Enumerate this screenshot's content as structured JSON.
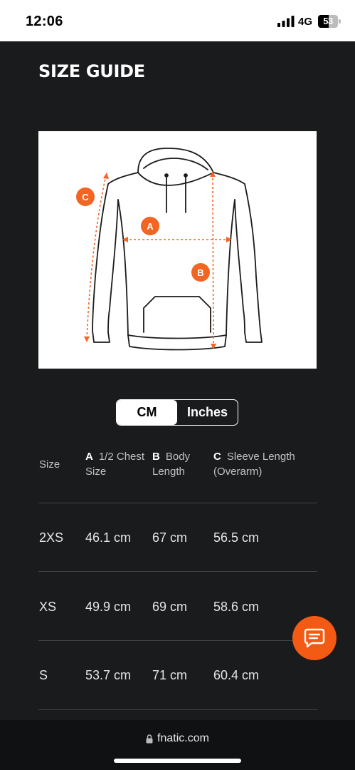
{
  "status_bar": {
    "time": "12:06",
    "network": "4G",
    "battery_percent": "53",
    "battery_level": 0.53,
    "icons": [
      "signal-icon",
      "battery-icon"
    ]
  },
  "page": {
    "title": "SIZE GUIDE"
  },
  "size_diagram": {
    "markers": {
      "a": "A",
      "b": "B",
      "c": "C"
    },
    "accent_color": "#f26522"
  },
  "unit_toggle": {
    "options": [
      "CM",
      "Inches"
    ],
    "selected": "CM"
  },
  "table": {
    "headers": {
      "size": "Size",
      "a_letter": "A",
      "a_label": "1/2 Chest Size",
      "b_letter": "B",
      "b_label": "Body Length",
      "c_letter": "C",
      "c_label": "Sleeve Length (Overarm)"
    },
    "rows": [
      {
        "size": "2XS",
        "a": "46.1 cm",
        "b": "67 cm",
        "c": "56.5 cm"
      },
      {
        "size": "XS",
        "a": "49.9 cm",
        "b": "69 cm",
        "c": "58.6 cm"
      },
      {
        "size": "S",
        "a": "53.7 cm",
        "b": "71 cm",
        "c": "60.4 cm"
      }
    ]
  },
  "chat": {
    "icon": "chat-icon",
    "color": "#f35a14"
  },
  "browser": {
    "url": "fnatic.com",
    "icon": "lock-icon"
  }
}
